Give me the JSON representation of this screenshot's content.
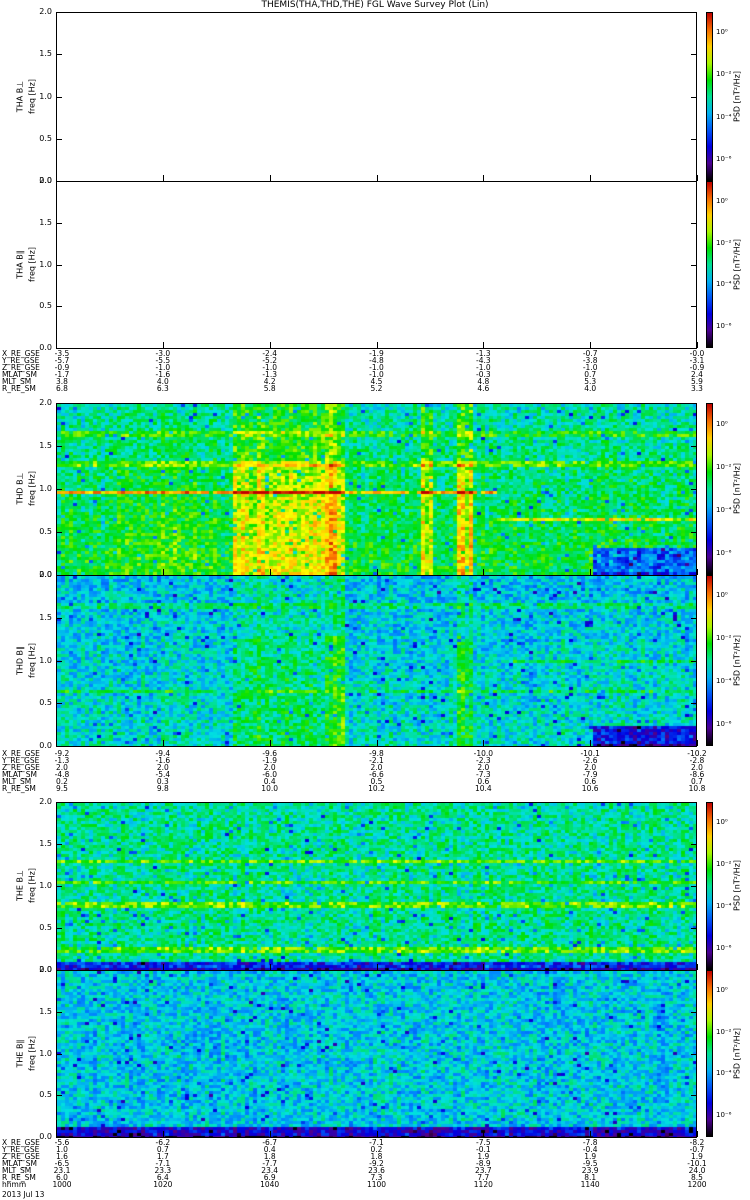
{
  "title": "THEMIS(THA,THD,THE) FGL Wave Survey Plot (Lin)",
  "freq_axis": {
    "label": "freq [Hz]",
    "ticks": [
      "0.0",
      "0.5",
      "1.0",
      "1.5",
      "2.0"
    ],
    "range": [
      0,
      2.0
    ]
  },
  "colorbar": {
    "label": "PSD [nT²/Hz]",
    "ticks": [
      "10⁰",
      "10⁻²",
      "10⁻⁴",
      "10⁻⁶"
    ],
    "tick_exponents": [
      0,
      -2,
      -4,
      -6
    ],
    "range_exponent": [
      -7,
      1
    ]
  },
  "chart_data": [
    {
      "type": "heatmap",
      "name": "THA B⊥",
      "label": "THA B⊥",
      "data": "none",
      "base": 0,
      "lines": [],
      "bursts": []
    },
    {
      "type": "heatmap",
      "name": "THA B∥",
      "label": "THA B∥",
      "data": "none",
      "base": 0,
      "lines": [],
      "bursts": []
    },
    {
      "type": "heatmap",
      "name": "THD B⊥",
      "label": "THD B⊥",
      "data": "yes",
      "base": 0.48,
      "lowfreq_boost": 0.1,
      "lines": [
        {
          "f": 0.97,
          "t": [
            0,
            82
          ],
          "s": 0.3
        },
        {
          "f": 0.65,
          "t": [
            82,
            120
          ],
          "s": 0.2
        },
        {
          "f": 1.3,
          "t": [
            0,
            120
          ],
          "s": 0.12
        },
        {
          "f": 1.65,
          "t": [
            0,
            120
          ],
          "s": 0.1
        }
      ],
      "bursts": [
        {
          "t": [
            33,
            50
          ],
          "s": 0.22
        },
        {
          "t": [
            50,
            54
          ],
          "s": 0.3
        },
        {
          "t": [
            68,
            70
          ],
          "s": 0.2
        },
        {
          "t": [
            75,
            78
          ],
          "s": 0.25
        },
        {
          "t": [
            11,
            30
          ],
          "s": 0.06
        }
      ],
      "quiet_low": {
        "t": [
          100,
          120
        ],
        "fmax": 0.3
      }
    },
    {
      "type": "heatmap",
      "name": "THD B∥",
      "label": "THD B∥",
      "data": "yes",
      "base": 0.42,
      "lowfreq_boost": 0.05,
      "lines": [
        {
          "f": 0.65,
          "t": [
            0,
            120
          ],
          "s": 0.1
        },
        {
          "f": 1.0,
          "t": [
            85,
            120
          ],
          "s": 0.1
        },
        {
          "f": 1.65,
          "t": [
            0,
            120
          ],
          "s": 0.08
        }
      ],
      "bursts": [
        {
          "t": [
            33,
            50
          ],
          "s": 0.1
        },
        {
          "t": [
            50,
            54
          ],
          "s": 0.16
        },
        {
          "t": [
            75,
            78
          ],
          "s": 0.12
        }
      ],
      "quiet_low": {
        "t": [
          100,
          120
        ],
        "fmax": 0.25
      }
    },
    {
      "type": "heatmap",
      "name": "THE B⊥",
      "label": "THE B⊥",
      "data": "yes",
      "base": 0.5,
      "lowfreq_boost": 0,
      "lines": [
        {
          "f": 1.3,
          "t": [
            0,
            120
          ],
          "s": 0.15
        },
        {
          "f": 1.05,
          "t": [
            0,
            120
          ],
          "s": 0.12
        },
        {
          "f": 0.78,
          "t": [
            0,
            120
          ],
          "s": 0.15
        },
        {
          "f": 0.25,
          "t": [
            0,
            120
          ],
          "s": 0.15
        }
      ],
      "bursts": [],
      "quiet_low": {
        "t": [
          0,
          120
        ],
        "fmax": 0.12
      }
    },
    {
      "type": "heatmap",
      "name": "THE B∥",
      "label": "THE B∥",
      "data": "yes",
      "base": 0.43,
      "lowfreq_boost": 0,
      "lines": [],
      "bursts": [],
      "quiet_low": {
        "t": [
          0,
          120
        ],
        "fmax": 0.15
      }
    }
  ],
  "ephemeris": [
    {
      "rows": [
        {
          "label": "X_RE_GSE",
          "values": [
            "-3.5",
            "-3.0",
            "-2.4",
            "-1.9",
            "-1.3",
            "-0.7",
            "-0.0"
          ]
        },
        {
          "label": "Y_RE_GSE",
          "values": [
            "-5.7",
            "-5.5",
            "-5.2",
            "-4.8",
            "-4.3",
            "-3.8",
            "-3.1"
          ]
        },
        {
          "label": "Z_RE_GSE",
          "values": [
            "-0.9",
            "-1.0",
            "-1.0",
            "-1.0",
            "-1.0",
            "-1.0",
            "-0.9"
          ]
        },
        {
          "label": "MLAT_SM",
          "values": [
            "-1.7",
            "-1.6",
            "-1.3",
            "-1.0",
            "-0.3",
            "0.7",
            "2.4"
          ]
        },
        {
          "label": "MLT_SM",
          "values": [
            "3.8",
            "4.0",
            "4.2",
            "4.5",
            "4.8",
            "5.3",
            "5.9"
          ]
        },
        {
          "label": "R_RE_SM",
          "values": [
            "6.8",
            "6.3",
            "5.8",
            "5.2",
            "4.6",
            "4.0",
            "3.3"
          ]
        }
      ]
    },
    {
      "rows": [
        {
          "label": "X_RE_GSE",
          "values": [
            "-9.2",
            "-9.4",
            "-9.6",
            "-9.8",
            "-10.0",
            "-10.1",
            "-10.2"
          ]
        },
        {
          "label": "Y_RE_GSE",
          "values": [
            "-1.3",
            "-1.6",
            "-1.9",
            "-2.1",
            "-2.3",
            "-2.6",
            "-2.8"
          ]
        },
        {
          "label": "Z_RE_GSE",
          "values": [
            "2.0",
            "2.0",
            "2.0",
            "2.0",
            "2.0",
            "2.0",
            "2.0"
          ]
        },
        {
          "label": "MLAT_SM",
          "values": [
            "-4.8",
            "-5.4",
            "-6.0",
            "-6.6",
            "-7.3",
            "-7.9",
            "-8.6"
          ]
        },
        {
          "label": "MLT_SM",
          "values": [
            "0.2",
            "0.3",
            "0.4",
            "0.5",
            "0.6",
            "0.6",
            "0.7"
          ]
        },
        {
          "label": "R_RE_SM",
          "values": [
            "9.5",
            "9.8",
            "10.0",
            "10.2",
            "10.4",
            "10.6",
            "10.8"
          ]
        }
      ]
    },
    {
      "rows": [
        {
          "label": "X_RE_GSE",
          "values": [
            "-5.6",
            "-6.2",
            "-6.7",
            "-7.1",
            "-7.5",
            "-7.8",
            "-8.2"
          ]
        },
        {
          "label": "Y_RE_GSE",
          "values": [
            "1.0",
            "0.7",
            "0.4",
            "0.2",
            "-0.1",
            "-0.4",
            "-0.7"
          ]
        },
        {
          "label": "Z_RE_GSE",
          "values": [
            "1.6",
            "1.7",
            "1.8",
            "1.8",
            "1.9",
            "1.9",
            "1.9"
          ]
        },
        {
          "label": "MLAT_SM",
          "values": [
            "-6.5",
            "-7.1",
            "-7.7",
            "-9.2",
            "-8.9",
            "-9.5",
            "-10.1"
          ]
        },
        {
          "label": "MLT_SM",
          "values": [
            "23.1",
            "23.3",
            "23.4",
            "23.6",
            "23.7",
            "23.9",
            "24.0"
          ]
        },
        {
          "label": "R_RE_SM",
          "values": [
            "6.0",
            "6.4",
            "6.9",
            "7.3",
            "7.7",
            "8.1",
            "8.5"
          ]
        },
        {
          "label": "hhmm",
          "values": [
            "1000",
            "1020",
            "1040",
            "1100",
            "1120",
            "1140",
            "1200"
          ]
        }
      ]
    }
  ],
  "date": "2013 Jul 13"
}
